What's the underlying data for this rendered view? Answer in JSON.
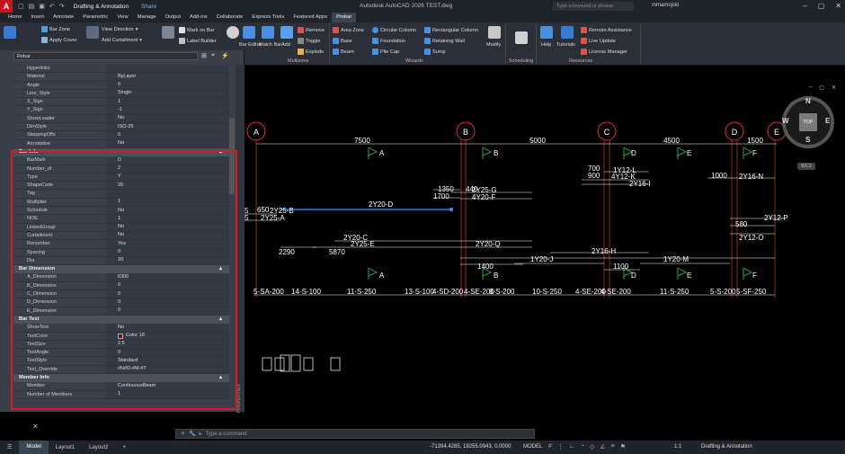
{
  "titlebar": {
    "logo_letter": "A",
    "workspace": "Drafting & Annotation",
    "share": "Share",
    "app_title": "Autodesk AutoCAD 2026   TEST.dwg",
    "search_placeholder": "Type a keyword or phrase",
    "user": "mmamojski"
  },
  "menu": [
    "Home",
    "Insert",
    "Annotate",
    "Parametric",
    "View",
    "Manage",
    "Output",
    "Add-ins",
    "Collaborate",
    "Express Tools",
    "Featured Apps",
    "Probar"
  ],
  "menu_active_index": 11,
  "ribbon": {
    "tools": {
      "bar_zone": "Bar Zone",
      "apply_cover": "Apply Cover",
      "view_direction": "View Direction",
      "add_curtailment": "Add Curtailment",
      "mark_on_bar": "Mark on Bar",
      "label_builder": "Label Builder",
      "bar_editor": "Bar Editor",
      "match_bar": "Match Bar",
      "add": "Add",
      "remove": "Remove",
      "toggle": "Toggle",
      "explode": "Explode",
      "area_zone": "Area Zone",
      "base": "Base",
      "beam": "Beam",
      "circular_column": "Circular Column",
      "foundation": "Foundation",
      "pile_cap": "Pile Cap",
      "rectangular_column": "Rectangular Column",
      "retaining_wall": "Retaining Wall",
      "sump": "Sump",
      "modify": "Modify",
      "help": "Help",
      "tutorials": "Tutorials",
      "remote_assistance": "Remote Assistance",
      "live_update": "Live Update",
      "license_manager": "License Manager"
    },
    "panels": {
      "multizone": "Multizone",
      "wizards": "Wizards",
      "scheduling": "Scheduling",
      "resources": "Resources"
    }
  },
  "palette": {
    "selector": "Rebar",
    "side_label": "PROPERTIES",
    "general": [
      {
        "k": "Hyperlinks",
        "v": ""
      },
      {
        "k": "Material",
        "v": "ByLayer"
      },
      {
        "k": "Angle",
        "v": "0"
      },
      {
        "k": "Line_Style",
        "v": "Single"
      },
      {
        "k": "X_Sign",
        "v": "1"
      },
      {
        "k": "Y_Sign",
        "v": "-1"
      },
      {
        "k": "ShowLeader",
        "v": "No"
      },
      {
        "k": "DimStyle",
        "v": "ISO-25"
      },
      {
        "k": "SteppingOffs",
        "v": "0"
      },
      {
        "k": "Annotative",
        "v": "No"
      }
    ],
    "categories": [
      {
        "title": "Bar Info",
        "rows": [
          {
            "k": "BarMark",
            "v": "D"
          },
          {
            "k": "Number_of",
            "v": "2"
          },
          {
            "k": "Type",
            "v": "Y"
          },
          {
            "k": "ShapeCode",
            "v": "20"
          },
          {
            "k": "Tag",
            "v": ""
          },
          {
            "k": "Multiplier",
            "v": "1"
          },
          {
            "k": "Schedule",
            "v": "No"
          },
          {
            "k": "NOE",
            "v": "1"
          },
          {
            "k": "LinkedGroup",
            "v": "No"
          },
          {
            "k": "Curtailment",
            "v": "No"
          },
          {
            "k": "Renumber",
            "v": "Yes"
          },
          {
            "k": "Spacing",
            "v": "0"
          },
          {
            "k": "Dia",
            "v": "20"
          }
        ]
      },
      {
        "title": "Bar Dimension",
        "rows": [
          {
            "k": "A_Dimension",
            "v": "6300"
          },
          {
            "k": "B_Dimension",
            "v": "0"
          },
          {
            "k": "C_Dimension",
            "v": "0"
          },
          {
            "k": "D_Dimension",
            "v": "0"
          },
          {
            "k": "E_Dimension",
            "v": "0"
          }
        ]
      },
      {
        "title": "Bar Text",
        "rows": [
          {
            "k": "ShowText",
            "v": "No"
          },
          {
            "k": "TextColor",
            "v": "Color 18",
            "swatch": true
          },
          {
            "k": "TextSize",
            "v": "2.5"
          },
          {
            "k": "TextAngle",
            "v": "0"
          },
          {
            "k": "TextStyle",
            "v": "Standard"
          },
          {
            "k": "Text_Override",
            "v": "#N#D-#M-#T"
          }
        ]
      },
      {
        "title": "Member Info",
        "rows": [
          {
            "k": "Member",
            "v": "ContinuousBeam"
          },
          {
            "k": "Number of Members",
            "v": "1"
          }
        ]
      }
    ]
  },
  "command": {
    "placeholder": "Type a command"
  },
  "status": {
    "tabs": [
      "Model",
      "Layout1",
      "Layout2"
    ],
    "coords": "-71394.4285, 19255.0943, 0.0000",
    "space": "MODEL",
    "scale": "1:1",
    "workspace": "Drafting & Annotation"
  },
  "viewcube": {
    "top": "TOP",
    "n": "N",
    "s": "S",
    "e": "E",
    "w": "W",
    "wcs": "WCS"
  },
  "drawing": {
    "grids": [
      "A",
      "B",
      "C",
      "D",
      "E"
    ],
    "spans": [
      "7500",
      "5000",
      "4500",
      "1500"
    ],
    "flags_top": [
      "A",
      "B",
      "D",
      "E",
      "F"
    ],
    "flags_bottom": [
      "A",
      "B",
      "D",
      "E",
      "F"
    ],
    "bar_labels": [
      "2Y20-D",
      "2Y25-B",
      "2Y25-A",
      "2Y20-C",
      "2Y25-E",
      "2Y20-Q",
      "2Y25-G",
      "4Y20-F",
      "2Y16-I",
      "4Y12-K",
      "1Y12-L",
      "2Y16-N",
      "2Y12-P",
      "2Y12-O",
      "2Y16-H",
      "1Y20-J",
      "1Y20-M"
    ],
    "numbers": [
      "650",
      "1350",
      "1700",
      "440",
      "700",
      "900",
      "1000",
      "580",
      "2290",
      "5870",
      "1400",
      "1100",
      "5",
      "5"
    ],
    "links": [
      "5-SA-200",
      "14-S-100",
      "11-S-250",
      "13-S-100",
      "4-SD-200",
      "4-SE-200",
      "8-S-200",
      "10-S-250",
      "4-SE-200",
      "4-SE-200",
      "11-S-250",
      "5-S-200",
      "5-SF-250"
    ]
  },
  "colors": {
    "accent": "#d21f1f",
    "bar_selected": "#3b7bd8",
    "flag": "#2ea043"
  }
}
